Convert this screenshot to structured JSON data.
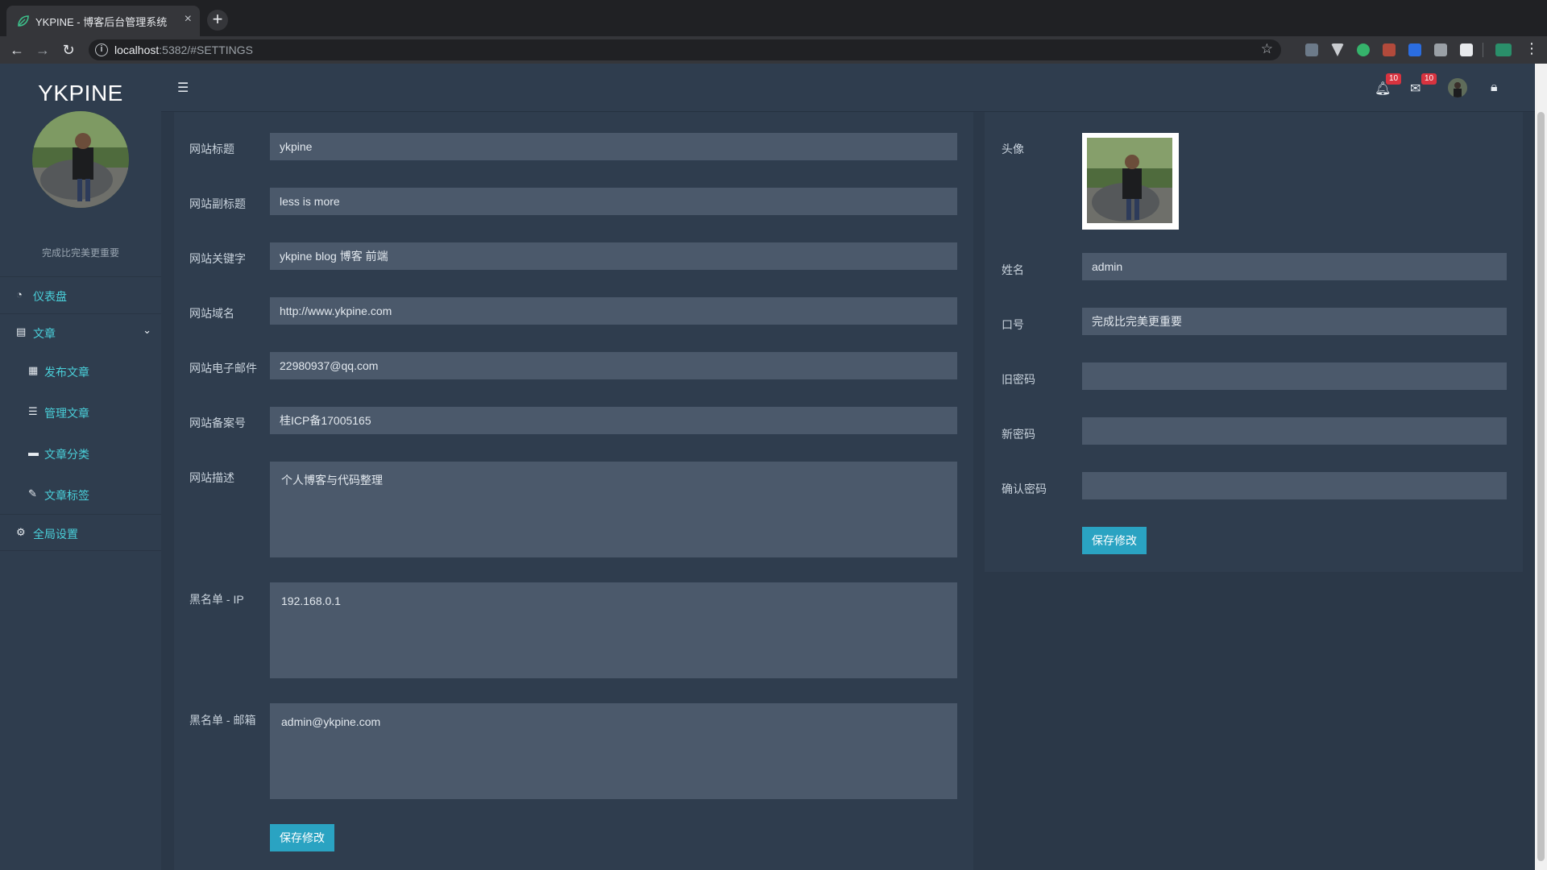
{
  "browser": {
    "tab_title": "YKPINE - 博客后台管理系统",
    "url_host": "localhost",
    "url_rest": ":5382/#SETTINGS"
  },
  "app": {
    "brand": "YKPINE",
    "motto": "完成比完美更重要",
    "nav": {
      "dashboard": "仪表盘",
      "articles": "文章",
      "publish": "发布文章",
      "manage": "管理文章",
      "categories": "文章分类",
      "tags": "文章标签",
      "settings": "全局设置"
    },
    "topbar": {
      "notifications_count": "10",
      "messages_count": "10"
    }
  },
  "site_settings": {
    "title_label": "网站标题",
    "title_value": "ykpine",
    "subtitle_label": "网站副标题",
    "subtitle_value": "less is more",
    "keywords_label": "网站关键字",
    "keywords_value": "ykpine blog 博客 前端",
    "domain_label": "网站域名",
    "domain_value": "http://www.ykpine.com",
    "email_label": "网站电子邮件",
    "email_value": "22980937@qq.com",
    "icp_label": "网站备案号",
    "icp_value": "桂ICP备17005165",
    "desc_label": "网站描述",
    "desc_value": "个人博客与代码整理",
    "blacklist_ip_label": "黑名单 - IP",
    "blacklist_ip_value": "192.168.0.1",
    "blacklist_email_label": "黑名单 - 邮箱",
    "blacklist_email_value": "admin@ykpine.com",
    "save_label": "保存修改"
  },
  "profile": {
    "avatar_label": "头像",
    "name_label": "姓名",
    "name_value": "admin",
    "motto_label": "口号",
    "motto_value": "完成比完美更重要",
    "old_password_label": "旧密码",
    "new_password_label": "新密码",
    "confirm_password_label": "确认密码",
    "save_label": "保存修改"
  },
  "colors": {
    "accent": "#4ad0da",
    "button": "#2aa3c2",
    "badge": "#d8333f",
    "sidebar": "#2f3d4e",
    "field": "#4b596b"
  },
  "icons": [
    "leaf-favicon",
    "back-icon",
    "forward-icon",
    "reload-icon",
    "info-icon",
    "star-icon",
    "dashboard-icon",
    "article-icon",
    "calendar-plus-icon",
    "list-icon",
    "briefcase-icon",
    "wrench-icon",
    "gears-icon",
    "bars-icon",
    "bell-icon",
    "envelope-icon",
    "lock-icon"
  ]
}
